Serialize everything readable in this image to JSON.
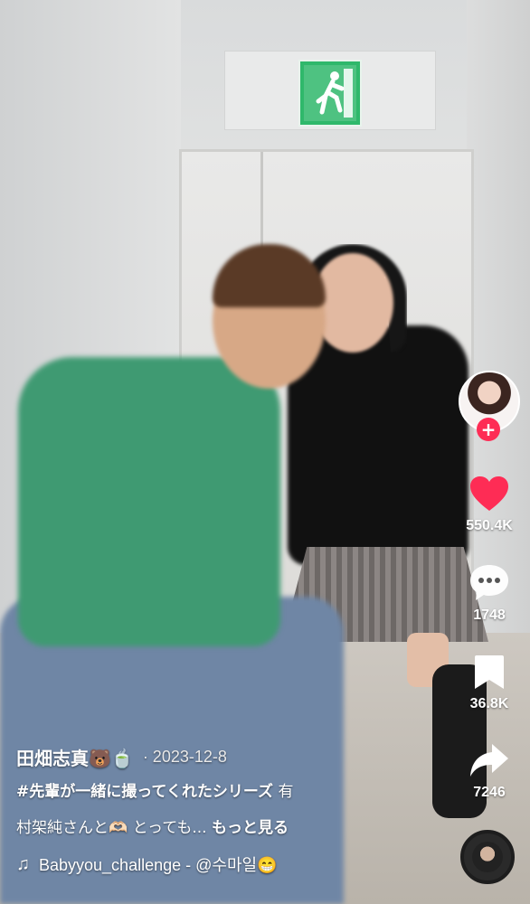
{
  "author": {
    "name": "田畑志真🐻🍵",
    "date": "· 2023-12-8"
  },
  "caption": {
    "hashtag": "#先輩が一緒に撮ってくれたシリーズ",
    "line1_rest": " 有",
    "line2": "村架純さんと🫶🏻 とっても... ",
    "more": "もっと見る"
  },
  "music": {
    "icon": "music-note-icon",
    "text": "Babyyou_challenge - @수마일😁"
  },
  "actions": {
    "likes": "550.4K",
    "comments": "1748",
    "saves": "36.8K",
    "shares": "7246"
  },
  "colors": {
    "like": "#fe2c55",
    "follow": "#fe2c55",
    "exit_sign": "#2fb86b"
  }
}
